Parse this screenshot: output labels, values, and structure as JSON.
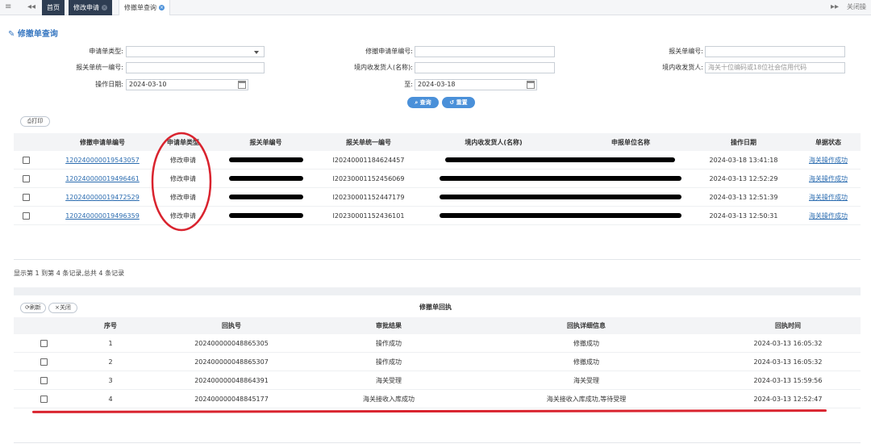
{
  "tabbar": {
    "tabs": [
      {
        "label": "首页"
      },
      {
        "label": "修改申请"
      },
      {
        "label": "修撤单查询"
      }
    ],
    "close_ops": "关闭操"
  },
  "page": {
    "title": "修撤单查询"
  },
  "form": {
    "type_label": "申请单类型:",
    "type_value": "",
    "revoke_no_label": "修撤申请单编号:",
    "revoke_no_value": "",
    "customs_no_label": "报关单编号:",
    "customs_no_value": "",
    "unified_no_label": "报关单统一编号:",
    "unified_no_value": "",
    "consignee_label": "境内收发货人(名称):",
    "consignee_value": "",
    "consignee2_label": "境内收发货人:",
    "consignee2_placeholder": "海关十位编码或18位社会信用代码",
    "date_label": "操作日期:",
    "date_from": "2024-03-10",
    "to_label": "至:",
    "date_to": "2024-03-18",
    "query_btn": "查询",
    "reset_btn": "重置"
  },
  "print_btn": "打印",
  "main_table": {
    "columns": [
      "修撤申请单编号",
      "申请单类型",
      "报关单编号",
      "报关单统一编号",
      "境内收发货人(名称)",
      "申报单位名称",
      "操作日期",
      "单据状态"
    ],
    "rows": [
      {
        "no": "120240000019543057",
        "type": "修改申请",
        "unified": "I20240001184624457",
        "date": "2024-03-18 13:41:18",
        "status": "海关操作成功"
      },
      {
        "no": "120240000019496461",
        "type": "修改申请",
        "unified": "I20230001152456069",
        "date": "2024-03-13 12:52:29",
        "status": "海关操作成功"
      },
      {
        "no": "120240000019472529",
        "type": "修改申请",
        "unified": "I20230001152447179",
        "date": "2024-03-13 12:51:39",
        "status": "海关操作成功"
      },
      {
        "no": "120240000019496359",
        "type": "修改申请",
        "unified": "I20230001152436101",
        "date": "2024-03-13 12:50:31",
        "status": "海关操作成功"
      }
    ]
  },
  "status_text": "显示第 1 到第 4 条记录,总共 4 条记录",
  "response": {
    "title": "修撤单回执",
    "refresh_btn": "刷新",
    "close_btn": "关闭",
    "columns": [
      "序号",
      "回执号",
      "审批结果",
      "回执详细信息",
      "回执时间"
    ],
    "rows": [
      {
        "seq": "1",
        "receipt": "202400000048865305",
        "result": "操作成功",
        "detail": "修撤成功",
        "time": "2024-03-13 16:05:32"
      },
      {
        "seq": "2",
        "receipt": "202400000048865307",
        "result": "操作成功",
        "detail": "修撤成功",
        "time": "2024-03-13 16:05:32"
      },
      {
        "seq": "3",
        "receipt": "202400000048864391",
        "result": "海关受理",
        "detail": "海关受理",
        "time": "2024-03-13 15:59:56"
      },
      {
        "seq": "4",
        "receipt": "202400000048845177",
        "result": "海关接收入库成功",
        "detail": "海关接收入库成功,等待受理",
        "time": "2024-03-13 12:52:47"
      }
    ]
  },
  "colors": {
    "accent": "#4a90d9",
    "tab_dark": "#2e3d52",
    "annotation": "#d9232e"
  }
}
